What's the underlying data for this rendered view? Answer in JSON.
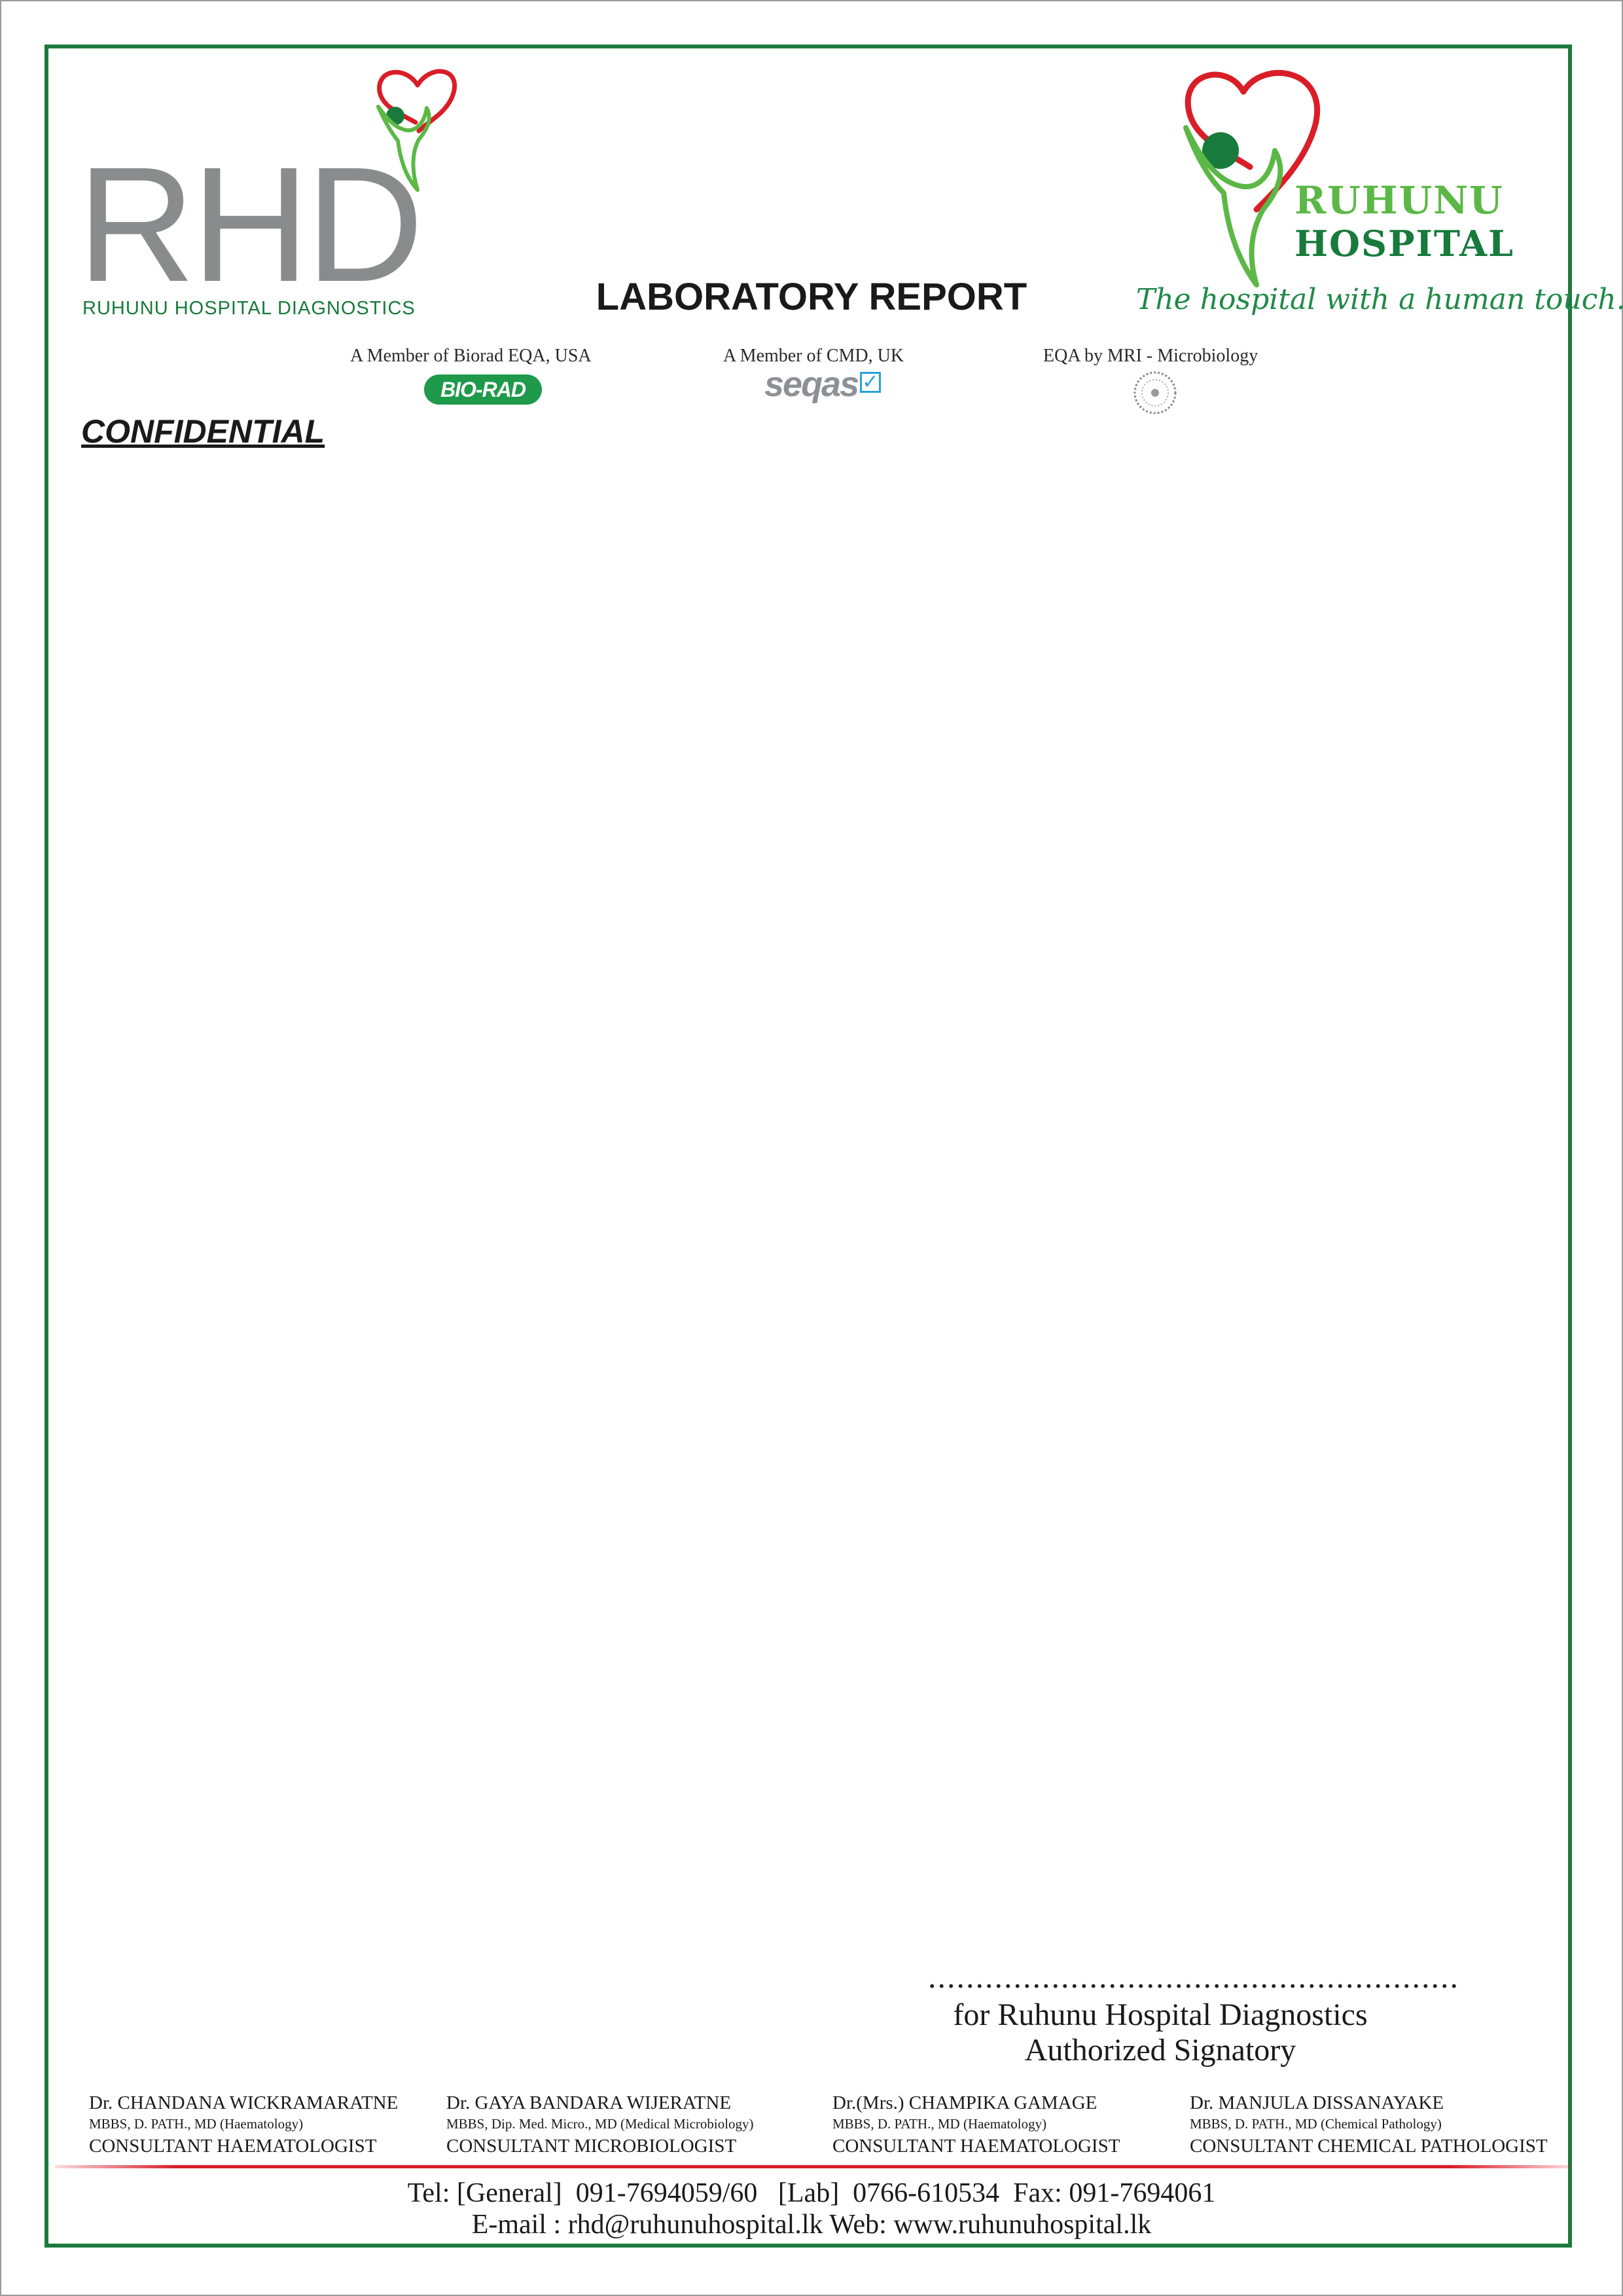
{
  "header": {
    "rhd_logo": {
      "letters": "RHD",
      "subtitle": "RUHUNU HOSPITAL DIAGNOSTICS"
    },
    "title": "LABORATORY REPORT",
    "hospital_logo": {
      "name_line1": "RUHUNU",
      "name_line2": "HOSPITAL",
      "tagline": "The hospital with a human touch..."
    }
  },
  "memberships": [
    {
      "text": "A Member of Biorad EQA, USA",
      "badge": "BIO-RAD"
    },
    {
      "text": "A Member of CMD, UK",
      "badge": "seqas"
    },
    {
      "text": "EQA by MRI - Microbiology"
    }
  ],
  "confidential": "CONFIDENTIAL",
  "signature": {
    "dots": "........................................................",
    "line1": "for Ruhunu Hospital Diagnostics",
    "line2": "Authorized Signatory"
  },
  "doctors": [
    {
      "name": "Dr. CHANDANA WICKRAMARATNE",
      "qualifications": "MBBS, D. PATH., MD (Haematology)",
      "role": "CONSULTANT HAEMATOLOGIST"
    },
    {
      "name": "Dr. GAYA BANDARA WIJERATNE",
      "qualifications": "MBBS, Dip. Med. Micro., MD (Medical Microbiology)",
      "role": "CONSULTANT MICROBIOLOGIST"
    },
    {
      "name": "Dr.(Mrs.) CHAMPIKA GAMAGE",
      "qualifications": "MBBS, D. PATH., MD (Haematology)",
      "role": "CONSULTANT HAEMATOLOGIST"
    },
    {
      "name": "Dr. MANJULA DISSANAYAKE",
      "qualifications": "MBBS, D. PATH., MD (Chemical Pathology)",
      "role": "CONSULTANT CHEMICAL PATHOLOGIST"
    }
  ],
  "contact": {
    "line1": "Tel: [General]  091-7694059/60   [Lab]  0766-610534  Fax: 091-7694061",
    "line2": "E-mail : rhd@ruhunuhospital.lk Web: www.ruhunuhospital.lk"
  },
  "colors": {
    "brand_green": "#1c7a3c",
    "light_green": "#5cb846",
    "heart_red": "#d91e28",
    "logo_gray": "#8a8b8d"
  }
}
